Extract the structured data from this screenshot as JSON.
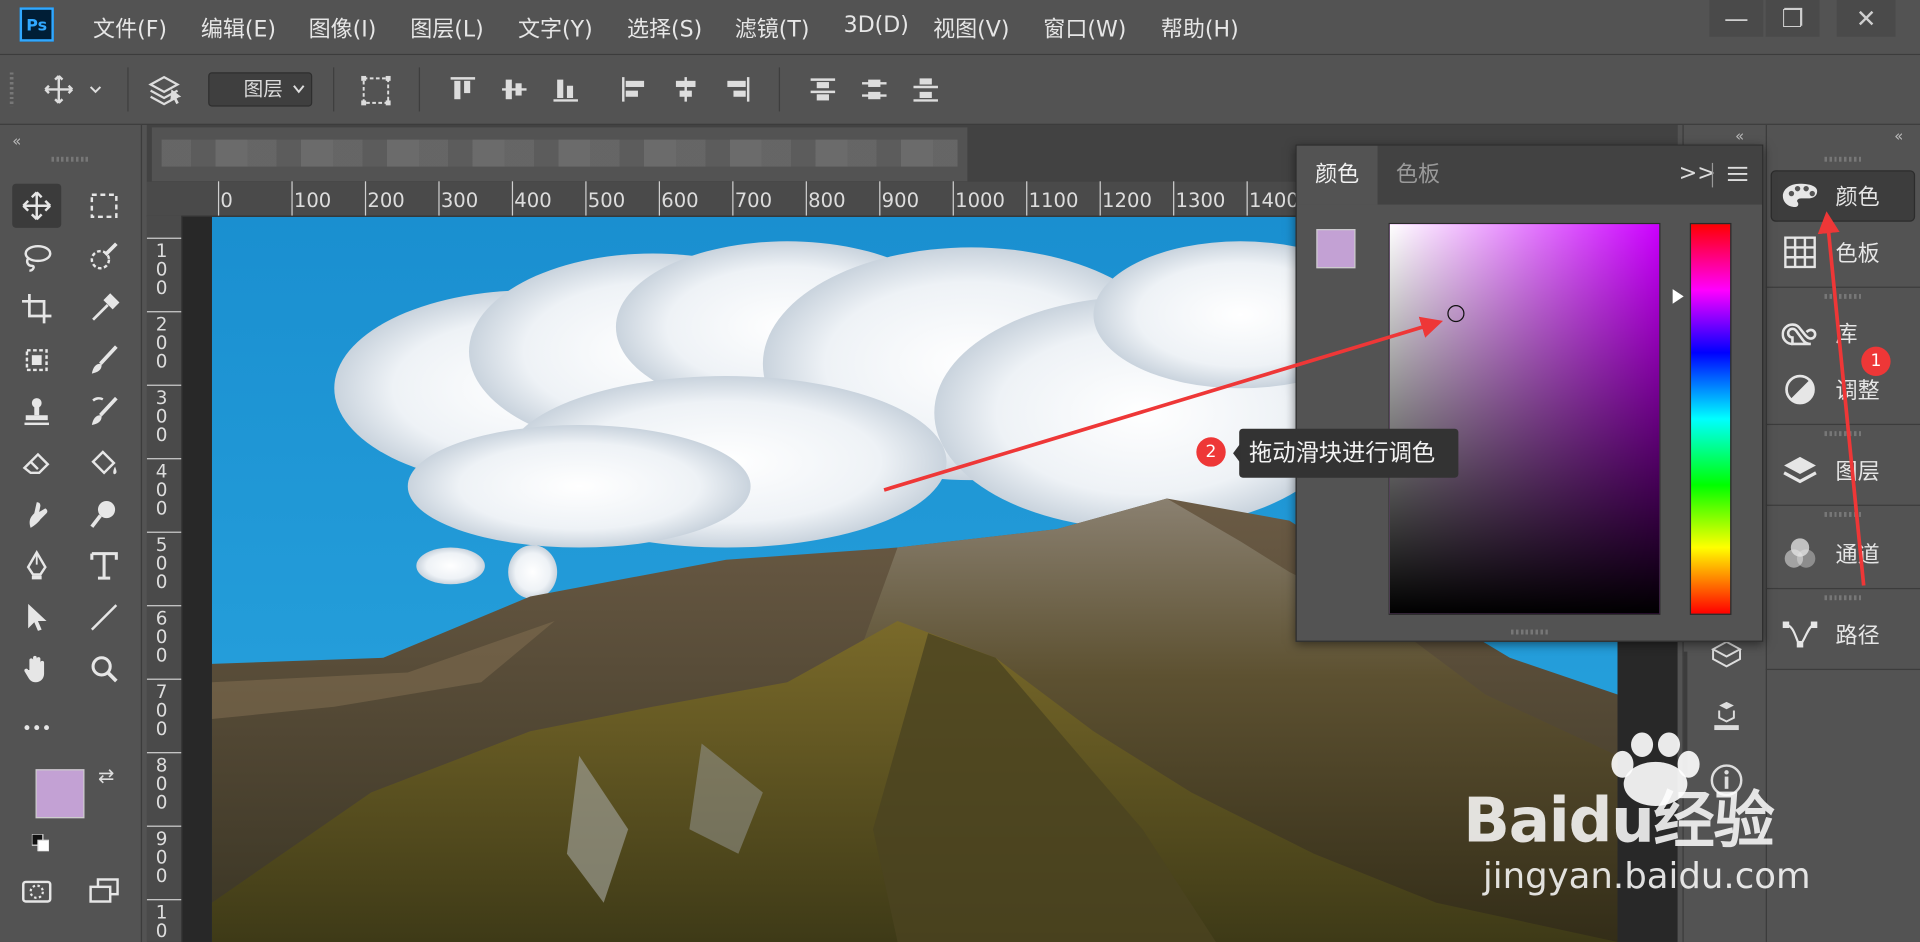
{
  "app": {
    "logo": "Ps"
  },
  "menu": [
    "文件(F)",
    "编辑(E)",
    "图像(I)",
    "图层(L)",
    "文字(Y)",
    "选择(S)",
    "滤镜(T)",
    "3D(D)",
    "视图(V)",
    "窗口(W)",
    "帮助(H)"
  ],
  "window_controls": {
    "minimize": "—",
    "restore": "❐",
    "close": "✕"
  },
  "options_bar": {
    "auto_select_target": "图层"
  },
  "ruler": {
    "horizontal": [
      "0",
      "100",
      "200",
      "300",
      "400",
      "500",
      "600",
      "700",
      "800",
      "900",
      "1000",
      "1100",
      "1200",
      "1300",
      "1400"
    ],
    "vertical": [
      "100",
      "200",
      "300",
      "400",
      "500",
      "600",
      "700",
      "800",
      "900",
      "10"
    ]
  },
  "colors": {
    "foreground": "#c3a1d4",
    "background": "#7cc69b",
    "accent_red": "#ee3737"
  },
  "color_panel": {
    "tabs": [
      "颜色",
      "色板"
    ],
    "hue_color": "#cc00ff",
    "menu_expand": ">>"
  },
  "right_panels": [
    {
      "label": "颜色",
      "icon": "palette-icon"
    },
    {
      "label": "色板",
      "icon": "grid-icon"
    },
    {
      "label": "库",
      "icon": "creative-cloud-icon"
    },
    {
      "label": "调整",
      "icon": "adjustment-icon"
    },
    {
      "label": "图层",
      "icon": "layers-icon"
    },
    {
      "label": "通道",
      "icon": "channels-icon"
    },
    {
      "label": "路径",
      "icon": "paths-icon"
    }
  ],
  "annotations": {
    "step1": "1",
    "step2": "2",
    "tooltip": "拖动滑块进行调色"
  },
  "watermark": {
    "brand": "Baidu经验",
    "url": "jingyan.baidu.com"
  }
}
